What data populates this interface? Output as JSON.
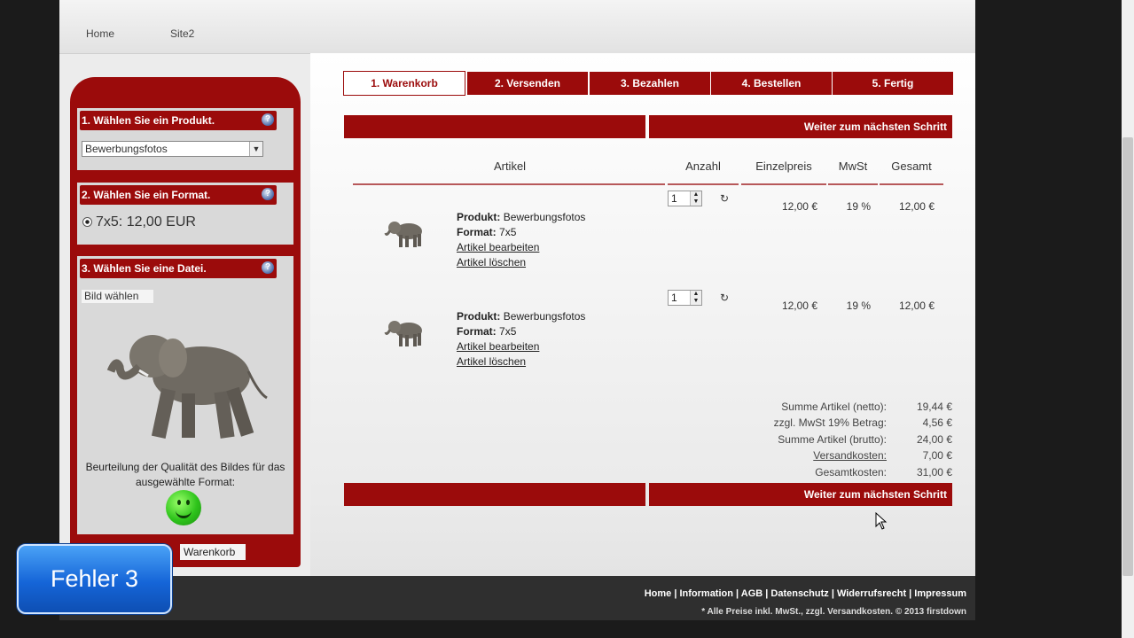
{
  "topnav": {
    "items": [
      "Home",
      "Site2"
    ]
  },
  "sidebar": {
    "box1": {
      "title": "1. Wählen Sie ein Produkt.",
      "selected": "Bewerbungsfotos"
    },
    "box2": {
      "title": "2. Wählen Sie ein Format.",
      "option": "7x5: 12,00 EUR"
    },
    "box3": {
      "title": "3. Wählen Sie eine Datei.",
      "file_button": "Bild wählen",
      "quality_text": "Beurteilung der Qualität des Bildes für das ausgewählte Format:"
    },
    "cart_button": "Warenkorb"
  },
  "steps": [
    "1. Warenkorb",
    "2. Versenden",
    "3. Bezahlen",
    "4. Bestellen",
    "5. Fertig"
  ],
  "next_step": "Weiter zum nächsten Schritt",
  "table": {
    "headers": [
      "Artikel",
      "Anzahl",
      "Einzelpreis",
      "MwSt",
      "Gesamt"
    ],
    "items": [
      {
        "product_label": "Produkt:",
        "product": "Bewerbungsfotos",
        "format_label": "Format:",
        "format": "7x5",
        "edit": "Artikel bearbeiten",
        "delete": "Artikel löschen",
        "qty": "1",
        "price": "12,00 €",
        "vat": "19 %",
        "total": "12,00 €"
      },
      {
        "product_label": "Produkt:",
        "product": "Bewerbungsfotos",
        "format_label": "Format:",
        "format": "7x5",
        "edit": "Artikel bearbeiten",
        "delete": "Artikel löschen",
        "qty": "1",
        "price": "12,00 €",
        "vat": "19 %",
        "total": "12,00 €"
      }
    ]
  },
  "summary": [
    {
      "label": "Summe Artikel (netto):",
      "value": "19,44 €"
    },
    {
      "label": "zzgl. MwSt 19% Betrag:",
      "value": "4,56 €"
    },
    {
      "label": "Summe Artikel (brutto):",
      "value": "24,00 €"
    },
    {
      "label": "Versandkosten:",
      "value": "7,00 €"
    },
    {
      "label": "Gesamtkosten:",
      "value": "31,00 €"
    }
  ],
  "footer": {
    "links": "Home | Information | AGB | Datenschutz | Widerrufsrecht | Impressum",
    "note": "* Alle Preise inkl. MwSt., zzgl. Versandkosten. © 2013 firstdown"
  },
  "overlay": {
    "badge": "Fehler 3"
  }
}
